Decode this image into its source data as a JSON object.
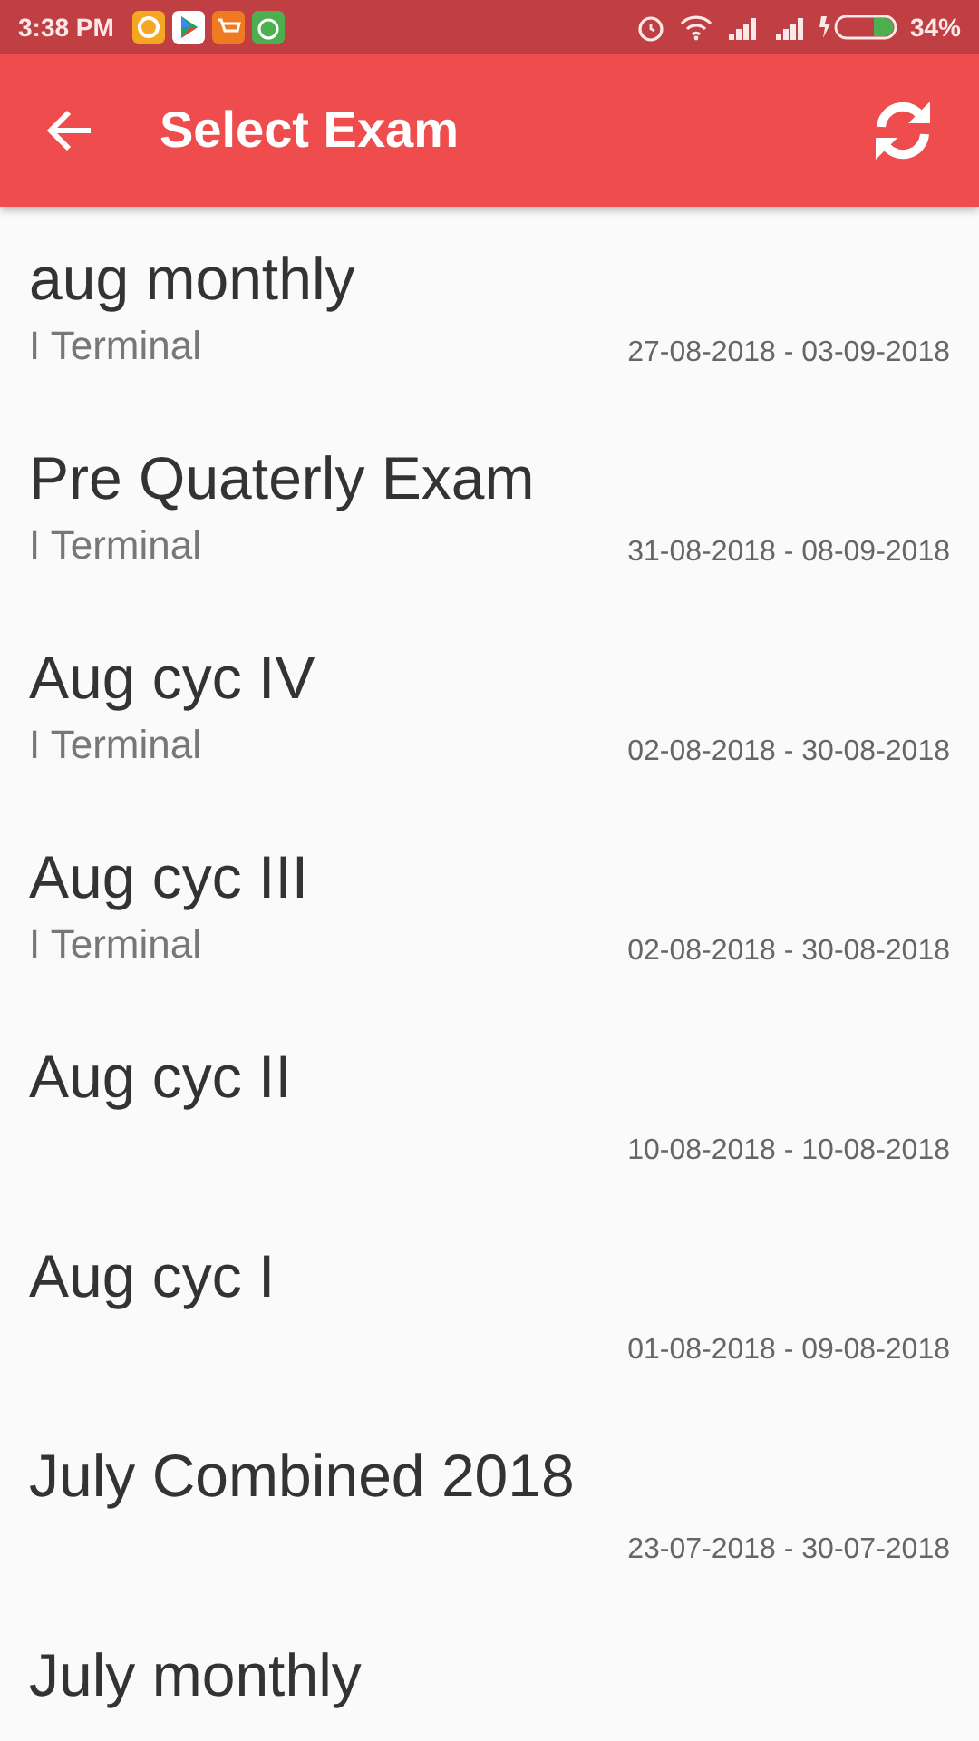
{
  "status_bar": {
    "time": "3:38 PM",
    "battery": "34%"
  },
  "app_bar": {
    "title": "Select Exam"
  },
  "exams": [
    {
      "name": "aug monthly",
      "term": "I Terminal",
      "dates": "27-08-2018 - 03-09-2018"
    },
    {
      "name": "Pre Quaterly Exam",
      "term": "I Terminal",
      "dates": "31-08-2018 - 08-09-2018"
    },
    {
      "name": "Aug cyc IV",
      "term": "I Terminal",
      "dates": "02-08-2018 - 30-08-2018"
    },
    {
      "name": "Aug cyc III",
      "term": "I Terminal",
      "dates": "02-08-2018 - 30-08-2018"
    },
    {
      "name": "Aug cyc II",
      "dates": "10-08-2018 - 10-08-2018"
    },
    {
      "name": "Aug cyc I",
      "dates": "01-08-2018 - 09-08-2018"
    },
    {
      "name": "July Combined 2018",
      "dates": "23-07-2018 - 30-07-2018"
    },
    {
      "name": "July monthly"
    }
  ]
}
